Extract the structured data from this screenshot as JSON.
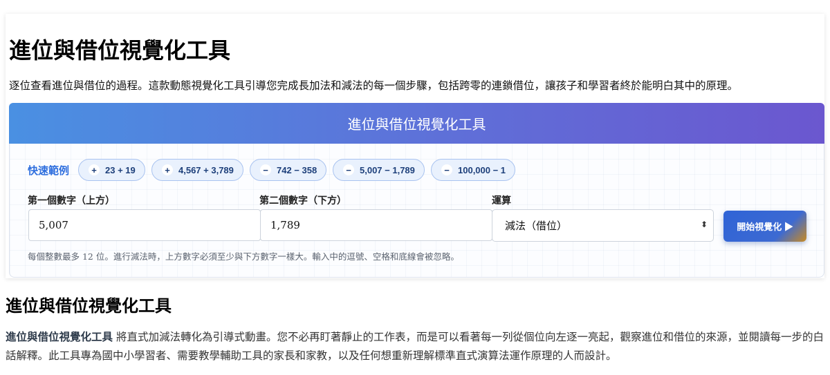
{
  "page": {
    "title": "進位與借位視覺化工具",
    "intro": "逐位查看進位與借位的過程。這款動態視覺化工具引導您完成長加法和減法的每一個步驟，包括跨零的連鎖借位，讓孩子和學習者終於能明白其中的原理。"
  },
  "tool": {
    "banner_title": "進位與借位視覺化工具",
    "quick_label": "快速範例",
    "examples": [
      {
        "op": "+",
        "label": "23 + 19"
      },
      {
        "op": "+",
        "label": "4,567 + 3,789"
      },
      {
        "op": "−",
        "label": "742 − 358"
      },
      {
        "op": "−",
        "label": "5,007 − 1,789"
      },
      {
        "op": "−",
        "label": "100,000 − 1"
      }
    ],
    "first_label": "第一個數字（上方）",
    "first_value": "5,007",
    "second_label": "第二個數字（下方）",
    "second_value": "1,789",
    "op_label": "運算",
    "op_value": "減法（借位）",
    "start_button": "開始視覺化 ▶",
    "hint": "每個整數最多 12 位。進行減法時，上方數字必須至少與下方數字一樣大。輸入中的逗號、空格和底線會被忽略。"
  },
  "section": {
    "title": "進位與借位視覺化工具",
    "bold_lead": "進位與借位視覺化工具",
    "body": " 將直式加減法轉化為引導式動畫。您不必再盯著靜止的工作表，而是可以看著每一列從個位向左逐一亮起，觀察進位和借位的來源，並閱讀每一步的白話解釋。此工具專為國中小學習者、需要教學輔助工具的家長和家教，以及任何想重新理解標準直式演算法運作原理的人而設計。"
  },
  "colors": {
    "accent": "#2f6fde",
    "banner_start": "#4a90e2",
    "banner_end": "#6b57cf"
  }
}
